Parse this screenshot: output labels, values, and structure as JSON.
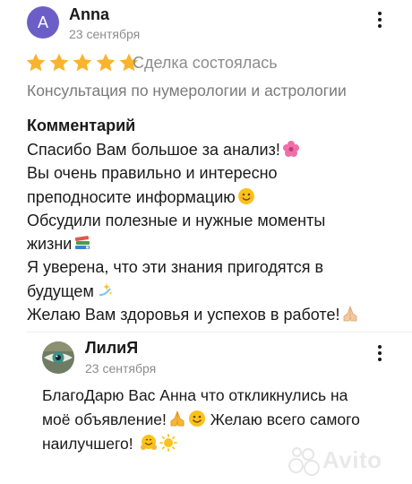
{
  "review": {
    "avatar_letter": "A",
    "author": "Anna",
    "date": "23 сентября",
    "rating": 5,
    "deal_status": "Сделка состоялась",
    "service": "Консультация по нумерологии и астрологии",
    "comment_heading": "Комментарий",
    "comment_lines": [
      "Спасибо Вам большое за анализ!",
      "Вы очень правильно и интересно",
      "преподносите информацию",
      "Обсудили полезные и нужные моменты",
      "жизни",
      "Я уверена, что эти знания пригодятся в",
      "будущем",
      "Желаю Вам здоровья и успехов в работе!"
    ]
  },
  "reply": {
    "author": "ЛилиЯ",
    "date": "23 сентября",
    "lines": [
      "БлагоДарю Вас Анна что откликнулись на",
      "моё объявление!",
      "Желаю всего самого",
      "наилучшего!"
    ]
  },
  "icons": {
    "star_color": "#f9b42b",
    "avatar_color": "#6b5fc7"
  },
  "watermark": "Avito"
}
